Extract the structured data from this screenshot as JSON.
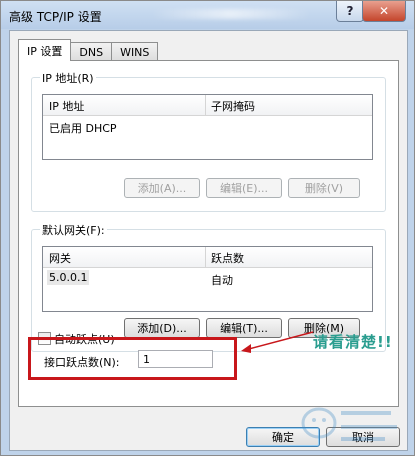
{
  "window": {
    "title": "高级 TCP/IP 设置",
    "help_label": "?",
    "close_label": "✕"
  },
  "tabs": [
    {
      "label": "IP 设置",
      "active": true
    },
    {
      "label": "DNS",
      "active": false
    },
    {
      "label": "WINS",
      "active": false
    }
  ],
  "ip_group": {
    "label": "IP 地址(R)",
    "columns": [
      "IP 地址",
      "子网掩码"
    ],
    "rows": [
      [
        "已启用 DHCP",
        ""
      ]
    ],
    "buttons": {
      "add": "添加(A)...",
      "edit": "编辑(E)...",
      "delete": "删除(V)"
    }
  },
  "gateway_group": {
    "label": "默认网关(F):",
    "columns": [
      "网关",
      "跃点数"
    ],
    "rows": [
      [
        "5.0.0.1",
        "自动"
      ]
    ],
    "buttons": {
      "add": "添加(D)...",
      "edit": "编辑(T)...",
      "delete": "删除(M)"
    }
  },
  "auto_metric": {
    "label": "自动跃点(U)",
    "checked": false
  },
  "interface_metric": {
    "label": "接口跃点数(N):",
    "value": "1"
  },
  "annotation": {
    "text": "请看清楚!!",
    "color": "#2a9d8f"
  },
  "footer": {
    "ok": "确定",
    "cancel": "取消"
  },
  "colors": {
    "annotation_box": "#c8171b",
    "close_button": "#c4452c"
  }
}
